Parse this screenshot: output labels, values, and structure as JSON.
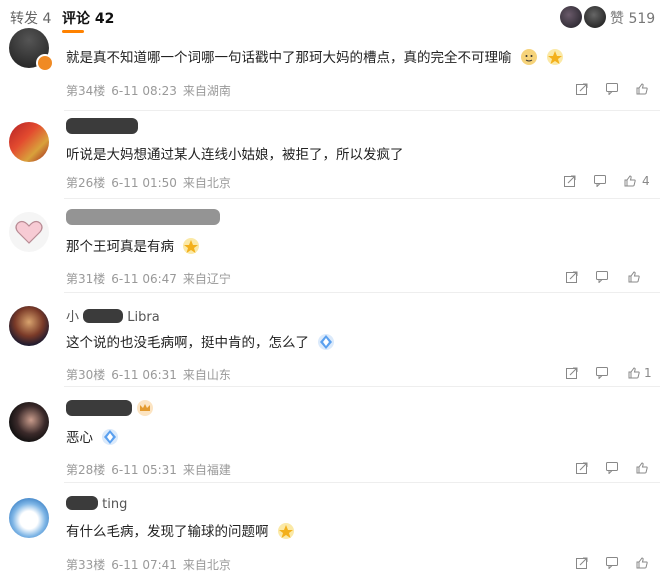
{
  "tabs": {
    "repost": "转发 4",
    "comments": "评论 42"
  },
  "likes_label": "赞 519",
  "comments": [
    {
      "username": "",
      "text": "就是真不知道哪一个词哪一句话戳中了那珂大妈的槽点，真的完全不可理喻",
      "floor": "第34楼",
      "date": "6-11 08:23",
      "location": "来自湖南",
      "likes": ""
    },
    {
      "username": "",
      "text": "听说是大妈想通过某人连线小姑娘，被拒了，所以发疯了",
      "floor": "第26楼",
      "date": "6-11 01:50",
      "location": "来自北京",
      "likes": "4"
    },
    {
      "username": "",
      "text": "那个王珂真是有病",
      "floor": "第31楼",
      "date": "6-11 06:47",
      "location": "来自辽宁",
      "likes": ""
    },
    {
      "username": "小",
      "username_suffix": "Libra",
      "text": "这个说的也没毛病啊，挺中肯的，怎么了",
      "floor": "第30楼",
      "date": "6-11 06:31",
      "location": "来自山东",
      "likes": "1"
    },
    {
      "username": "",
      "text": "恶心",
      "floor": "第28楼",
      "date": "6-11 05:31",
      "location": "来自福建",
      "likes": ""
    },
    {
      "username": "",
      "username_suffix": "ting",
      "text": "有什么毛病，发现了输球的问题啊",
      "floor": "第33楼",
      "date": "6-11 07:41",
      "location": "来自北京",
      "likes": ""
    }
  ],
  "icons": {
    "share": "share-icon",
    "reply": "reply-icon",
    "like": "thumbs-up-icon"
  },
  "colors": {
    "accent": "#ff8200",
    "meta": "#999999"
  }
}
